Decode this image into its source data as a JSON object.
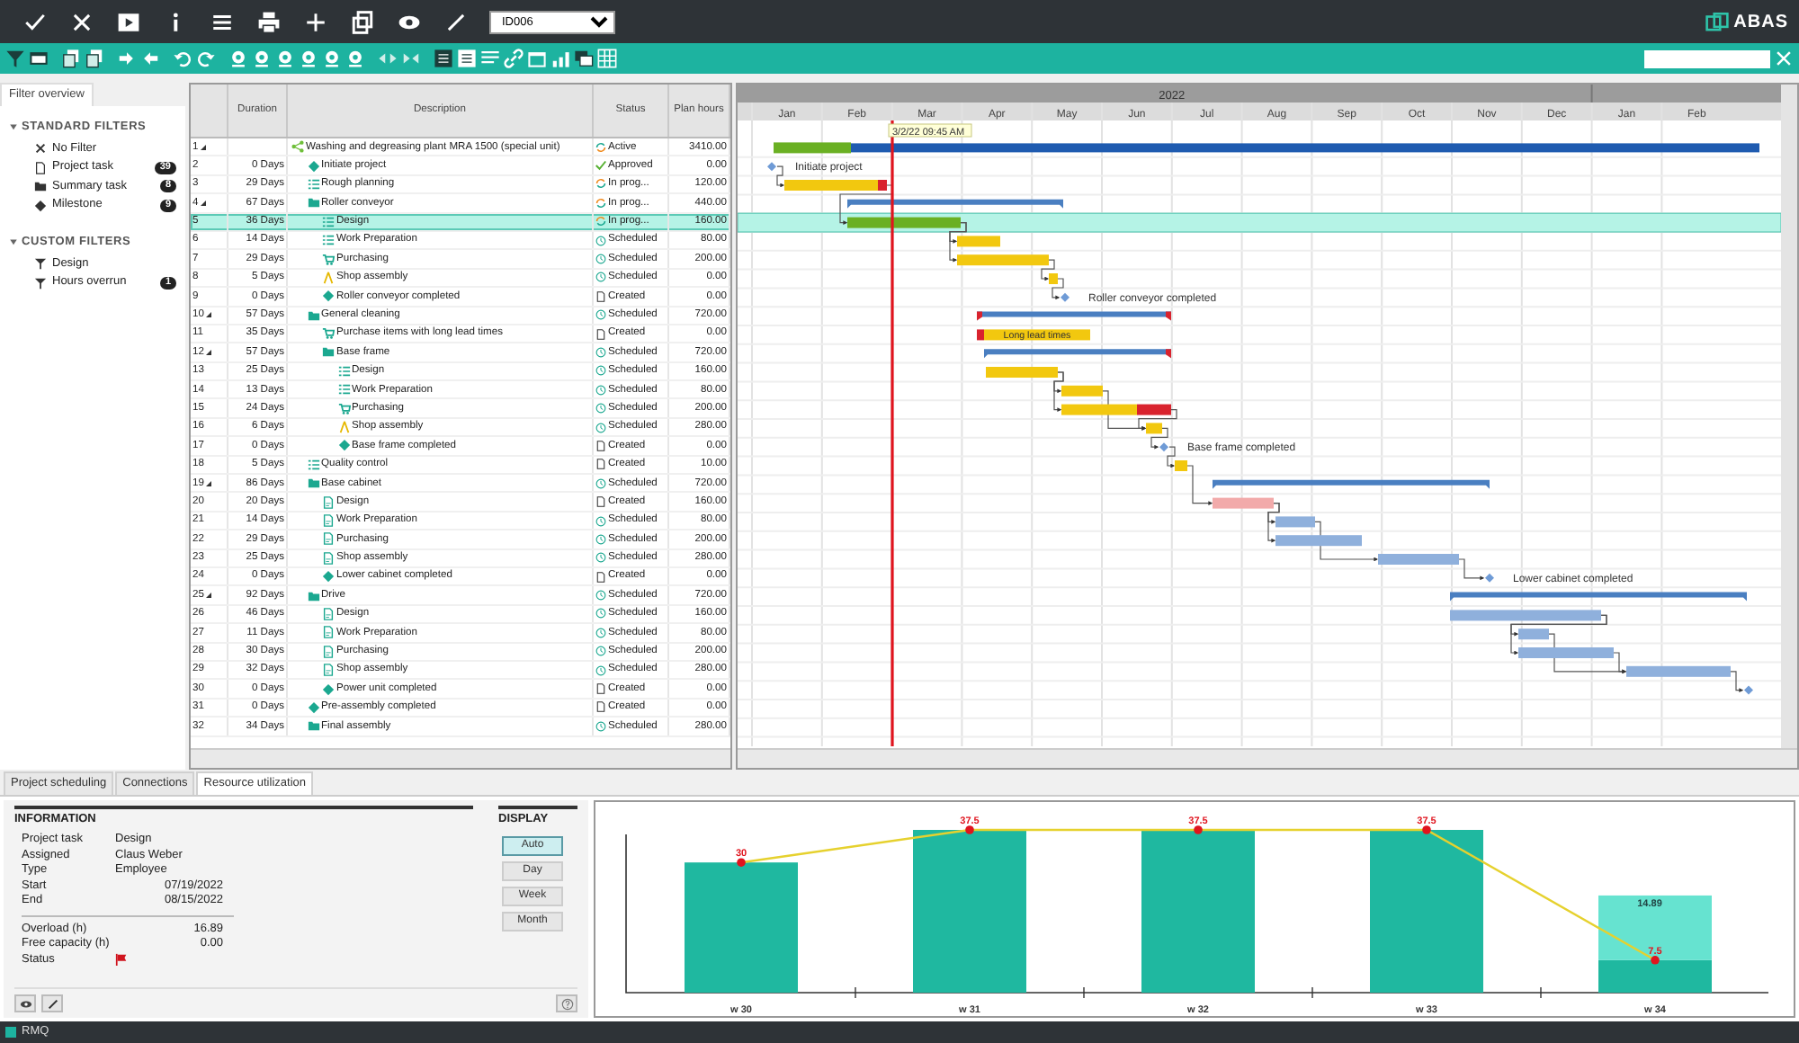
{
  "top_bar": {
    "record": "ID006",
    "brand": "ABAS"
  },
  "filter_panel": {
    "tab": "Filter overview",
    "sections": [
      {
        "title": "STANDARD FILTERS",
        "items": [
          {
            "label": "No Filter",
            "kind": "none"
          },
          {
            "label": "Project task",
            "kind": "task",
            "count": "39"
          },
          {
            "label": "Summary task",
            "kind": "folder",
            "count": "8"
          },
          {
            "label": "Milestone",
            "kind": "milestone",
            "count": "9"
          }
        ]
      },
      {
        "title": "CUSTOM FILTERS",
        "items": [
          {
            "label": "Design",
            "kind": "filter"
          },
          {
            "label": "Hours overrun",
            "kind": "filter",
            "count": "1"
          }
        ]
      }
    ]
  },
  "table": {
    "columns": [
      "Duration",
      "Description",
      "Status",
      "Plan hours"
    ],
    "rows": [
      {
        "number": "1",
        "duration": "",
        "description": "Washing and degreasing plant MRA 1500 (special unit)",
        "kind": "project",
        "status": {
          "text": "Active",
          "kind": "active"
        },
        "hours": "3410.00",
        "selected": false,
        "children": [
          {
            "number": "2",
            "duration": "0 Days",
            "description": "Initiate project",
            "kind": "milestone",
            "status": {
              "text": "Approved",
              "kind": "approved"
            },
            "hours": "0.00",
            "selected": false,
            "gantt_label": "Initiate project"
          },
          {
            "number": "3",
            "duration": "29 Days",
            "description": "Rough planning",
            "kind": "checklist",
            "status": {
              "text": "In prog...",
              "kind": "progress"
            },
            "hours": "120.00",
            "selected": false
          },
          {
            "number": "4",
            "duration": "67 Days",
            "description": "Roller conveyor",
            "kind": "summary",
            "status": {
              "text": "In prog...",
              "kind": "progress"
            },
            "hours": "440.00",
            "selected": false,
            "children": [
              {
                "number": "5",
                "duration": "36 Days",
                "description": "Design",
                "kind": "checklist",
                "status": {
                  "text": "In prog...",
                  "kind": "progress"
                },
                "hours": "160.00",
                "selected": true
              },
              {
                "number": "6",
                "duration": "14 Days",
                "description": "Work Preparation",
                "kind": "checklist",
                "status": {
                  "text": "Scheduled",
                  "kind": "scheduled"
                },
                "hours": "80.00",
                "selected": false
              },
              {
                "number": "7",
                "duration": "29 Days",
                "description": "Purchasing",
                "kind": "purchase",
                "status": {
                  "text": "Scheduled",
                  "kind": "scheduled"
                },
                "hours": "200.00",
                "selected": false
              },
              {
                "number": "8",
                "duration": "5 Days",
                "description": "Shop assembly",
                "kind": "assembly",
                "status": {
                  "text": "Scheduled",
                  "kind": "scheduled"
                },
                "hours": "0.00",
                "selected": false
              },
              {
                "number": "9",
                "duration": "0 Days",
                "description": "Roller conveyor completed",
                "kind": "milestone",
                "status": {
                  "text": "Created",
                  "kind": "created"
                },
                "hours": "0.00",
                "selected": false,
                "gantt_label": "Roller conveyor completed"
              }
            ]
          },
          {
            "number": "10",
            "duration": "57 Days",
            "description": "General cleaning",
            "kind": "summary",
            "status": {
              "text": "Scheduled",
              "kind": "scheduled"
            },
            "hours": "720.00",
            "selected": false,
            "children": [
              {
                "number": "11",
                "duration": "35 Days",
                "description": "Purchase items with long lead times",
                "kind": "purchase",
                "status": {
                  "text": "Created",
                  "kind": "created"
                },
                "hours": "0.00",
                "selected": false,
                "gantt_label": "Long lead times"
              },
              {
                "number": "12",
                "duration": "57 Days",
                "description": "Base frame",
                "kind": "summary",
                "status": {
                  "text": "Scheduled",
                  "kind": "scheduled"
                },
                "hours": "720.00",
                "selected": false,
                "children": [
                  {
                    "number": "13",
                    "duration": "25 Days",
                    "description": "Design",
                    "kind": "checklist",
                    "status": {
                      "text": "Scheduled",
                      "kind": "scheduled"
                    },
                    "hours": "160.00",
                    "selected": false
                  },
                  {
                    "number": "14",
                    "duration": "13 Days",
                    "description": "Work Preparation",
                    "kind": "checklist",
                    "status": {
                      "text": "Scheduled",
                      "kind": "scheduled"
                    },
                    "hours": "80.00",
                    "selected": false
                  },
                  {
                    "number": "15",
                    "duration": "24 Days",
                    "description": "Purchasing",
                    "kind": "purchase",
                    "status": {
                      "text": "Scheduled",
                      "kind": "scheduled"
                    },
                    "hours": "200.00",
                    "selected": false
                  },
                  {
                    "number": "16",
                    "duration": "6 Days",
                    "description": "Shop assembly",
                    "kind": "assembly",
                    "status": {
                      "text": "Scheduled",
                      "kind": "scheduled"
                    },
                    "hours": "280.00",
                    "selected": false
                  },
                  {
                    "number": "17",
                    "duration": "0 Days",
                    "description": "Base frame completed",
                    "kind": "milestone",
                    "status": {
                      "text": "Created",
                      "kind": "created"
                    },
                    "hours": "0.00",
                    "selected": false,
                    "gantt_label": "Base frame completed"
                  }
                ]
              }
            ]
          },
          {
            "number": "18",
            "duration": "5 Days",
            "description": "Quality control",
            "kind": "checklist",
            "status": {
              "text": "Created",
              "kind": "created"
            },
            "hours": "10.00",
            "selected": false
          },
          {
            "number": "19",
            "duration": "86 Days",
            "description": "Base cabinet",
            "kind": "summary",
            "status": {
              "text": "Scheduled",
              "kind": "scheduled"
            },
            "hours": "720.00",
            "selected": false,
            "children": [
              {
                "number": "20",
                "duration": "20 Days",
                "description": "Design",
                "kind": "doc",
                "status": {
                  "text": "Created",
                  "kind": "created"
                },
                "hours": "160.00",
                "selected": false
              },
              {
                "number": "21",
                "duration": "14 Days",
                "description": "Work Preparation",
                "kind": "doc",
                "status": {
                  "text": "Scheduled",
                  "kind": "scheduled"
                },
                "hours": "80.00",
                "selected": false
              },
              {
                "number": "22",
                "duration": "29 Days",
                "description": "Purchasing",
                "kind": "doc",
                "status": {
                  "text": "Scheduled",
                  "kind": "scheduled"
                },
                "hours": "200.00",
                "selected": false
              },
              {
                "number": "23",
                "duration": "25 Days",
                "description": "Shop assembly",
                "kind": "doc",
                "status": {
                  "text": "Scheduled",
                  "kind": "scheduled"
                },
                "hours": "280.00",
                "selected": false
              },
              {
                "number": "24",
                "duration": "0 Days",
                "description": "Lower cabinet completed",
                "kind": "milestone",
                "status": {
                  "text": "Created",
                  "kind": "created"
                },
                "hours": "0.00",
                "selected": false,
                "gantt_label": "Lower cabinet completed"
              }
            ]
          },
          {
            "number": "25",
            "duration": "92 Days",
            "description": "Drive",
            "kind": "summary",
            "status": {
              "text": "Scheduled",
              "kind": "scheduled"
            },
            "hours": "720.00",
            "selected": false,
            "children": [
              {
                "number": "26",
                "duration": "46 Days",
                "description": "Design",
                "kind": "doc",
                "status": {
                  "text": "Scheduled",
                  "kind": "scheduled"
                },
                "hours": "160.00",
                "selected": false
              },
              {
                "number": "27",
                "duration": "11 Days",
                "description": "Work Preparation",
                "kind": "doc",
                "status": {
                  "text": "Scheduled",
                  "kind": "scheduled"
                },
                "hours": "80.00",
                "selected": false
              },
              {
                "number": "28",
                "duration": "30 Days",
                "description": "Purchasing",
                "kind": "doc",
                "status": {
                  "text": "Scheduled",
                  "kind": "scheduled"
                },
                "hours": "200.00",
                "selected": false
              },
              {
                "number": "29",
                "duration": "32 Days",
                "description": "Shop assembly",
                "kind": "doc",
                "status": {
                  "text": "Scheduled",
                  "kind": "scheduled"
                },
                "hours": "280.00",
                "selected": false
              },
              {
                "number": "30",
                "duration": "0 Days",
                "description": "Power unit completed",
                "kind": "milestone",
                "status": {
                  "text": "Created",
                  "kind": "created"
                },
                "hours": "0.00",
                "selected": false
              }
            ]
          },
          {
            "number": "31",
            "duration": "0 Days",
            "description": "Pre-assembly completed",
            "kind": "milestone",
            "status": {
              "text": "Created",
              "kind": "created"
            },
            "hours": "0.00",
            "selected": false
          },
          {
            "number": "32",
            "duration": "34 Days",
            "description": "Final assembly",
            "kind": "summary",
            "status": {
              "text": "Scheduled",
              "kind": "scheduled"
            },
            "hours": "280.00",
            "selected": false
          }
        ]
      }
    ]
  },
  "gantt": {
    "year": "2022",
    "months": [
      "Jan",
      "Feb",
      "Mar",
      "Apr",
      "May",
      "Jun",
      "Jul",
      "Aug",
      "Sep",
      "Oct",
      "Nov",
      "Dec",
      "Jan",
      "Feb"
    ],
    "today": "3/2/22 09:45 AM"
  },
  "bottom_tabs": [
    {
      "label": "Project scheduling",
      "selected": false
    },
    {
      "label": "Connections",
      "selected": false
    },
    {
      "label": "Resource utilization",
      "selected": true
    }
  ],
  "information": {
    "title": "INFORMATION",
    "fields": [
      {
        "label": "Project task",
        "value": "Design",
        "kind": "text"
      },
      {
        "label": "Assigned",
        "value": "Claus Weber",
        "kind": "text"
      },
      {
        "label": "Type",
        "value": "Employee",
        "kind": "text"
      },
      {
        "label": "Start",
        "value": "07/19/2022",
        "kind": "number"
      },
      {
        "label": "End",
        "value": "08/15/2022",
        "kind": "number"
      }
    ],
    "totals": [
      {
        "label": "Overload (h)",
        "value": "16.89",
        "kind": "number"
      },
      {
        "label": "Free capacity (h)",
        "value": "0.00",
        "kind": "number"
      },
      {
        "label": "Status",
        "kind": "flag"
      }
    ]
  },
  "display": {
    "title": "DISPLAY",
    "buttons": [
      {
        "label": "Auto",
        "selected": true
      },
      {
        "label": "Day",
        "selected": false
      },
      {
        "label": "Week",
        "selected": false
      },
      {
        "label": "Month",
        "selected": false
      }
    ]
  },
  "chart_data": {
    "type": "bar",
    "stacked": true,
    "categories": [
      "w 30",
      "w 31",
      "w 32",
      "w 33",
      "w 34"
    ],
    "series": [
      {
        "color": "#1fb8a0",
        "values": [
          30,
          37.5,
          37.5,
          37.5,
          7.5
        ]
      },
      {
        "color": "#66e3d0",
        "values": [
          0,
          0,
          0,
          0,
          14.89
        ],
        "value_labels": [
          null,
          null,
          null,
          null,
          "14.89"
        ]
      },
      {
        "color": "#e6d12e",
        "values": [
          30,
          37.5,
          37.5,
          37.5,
          7.5
        ],
        "type": "line",
        "marker": "circle",
        "value_labels": [
          "30",
          "37.5",
          "37.5",
          "37.5",
          "7.5"
        ]
      }
    ]
  },
  "status_bar": {
    "text": "RMQ"
  }
}
